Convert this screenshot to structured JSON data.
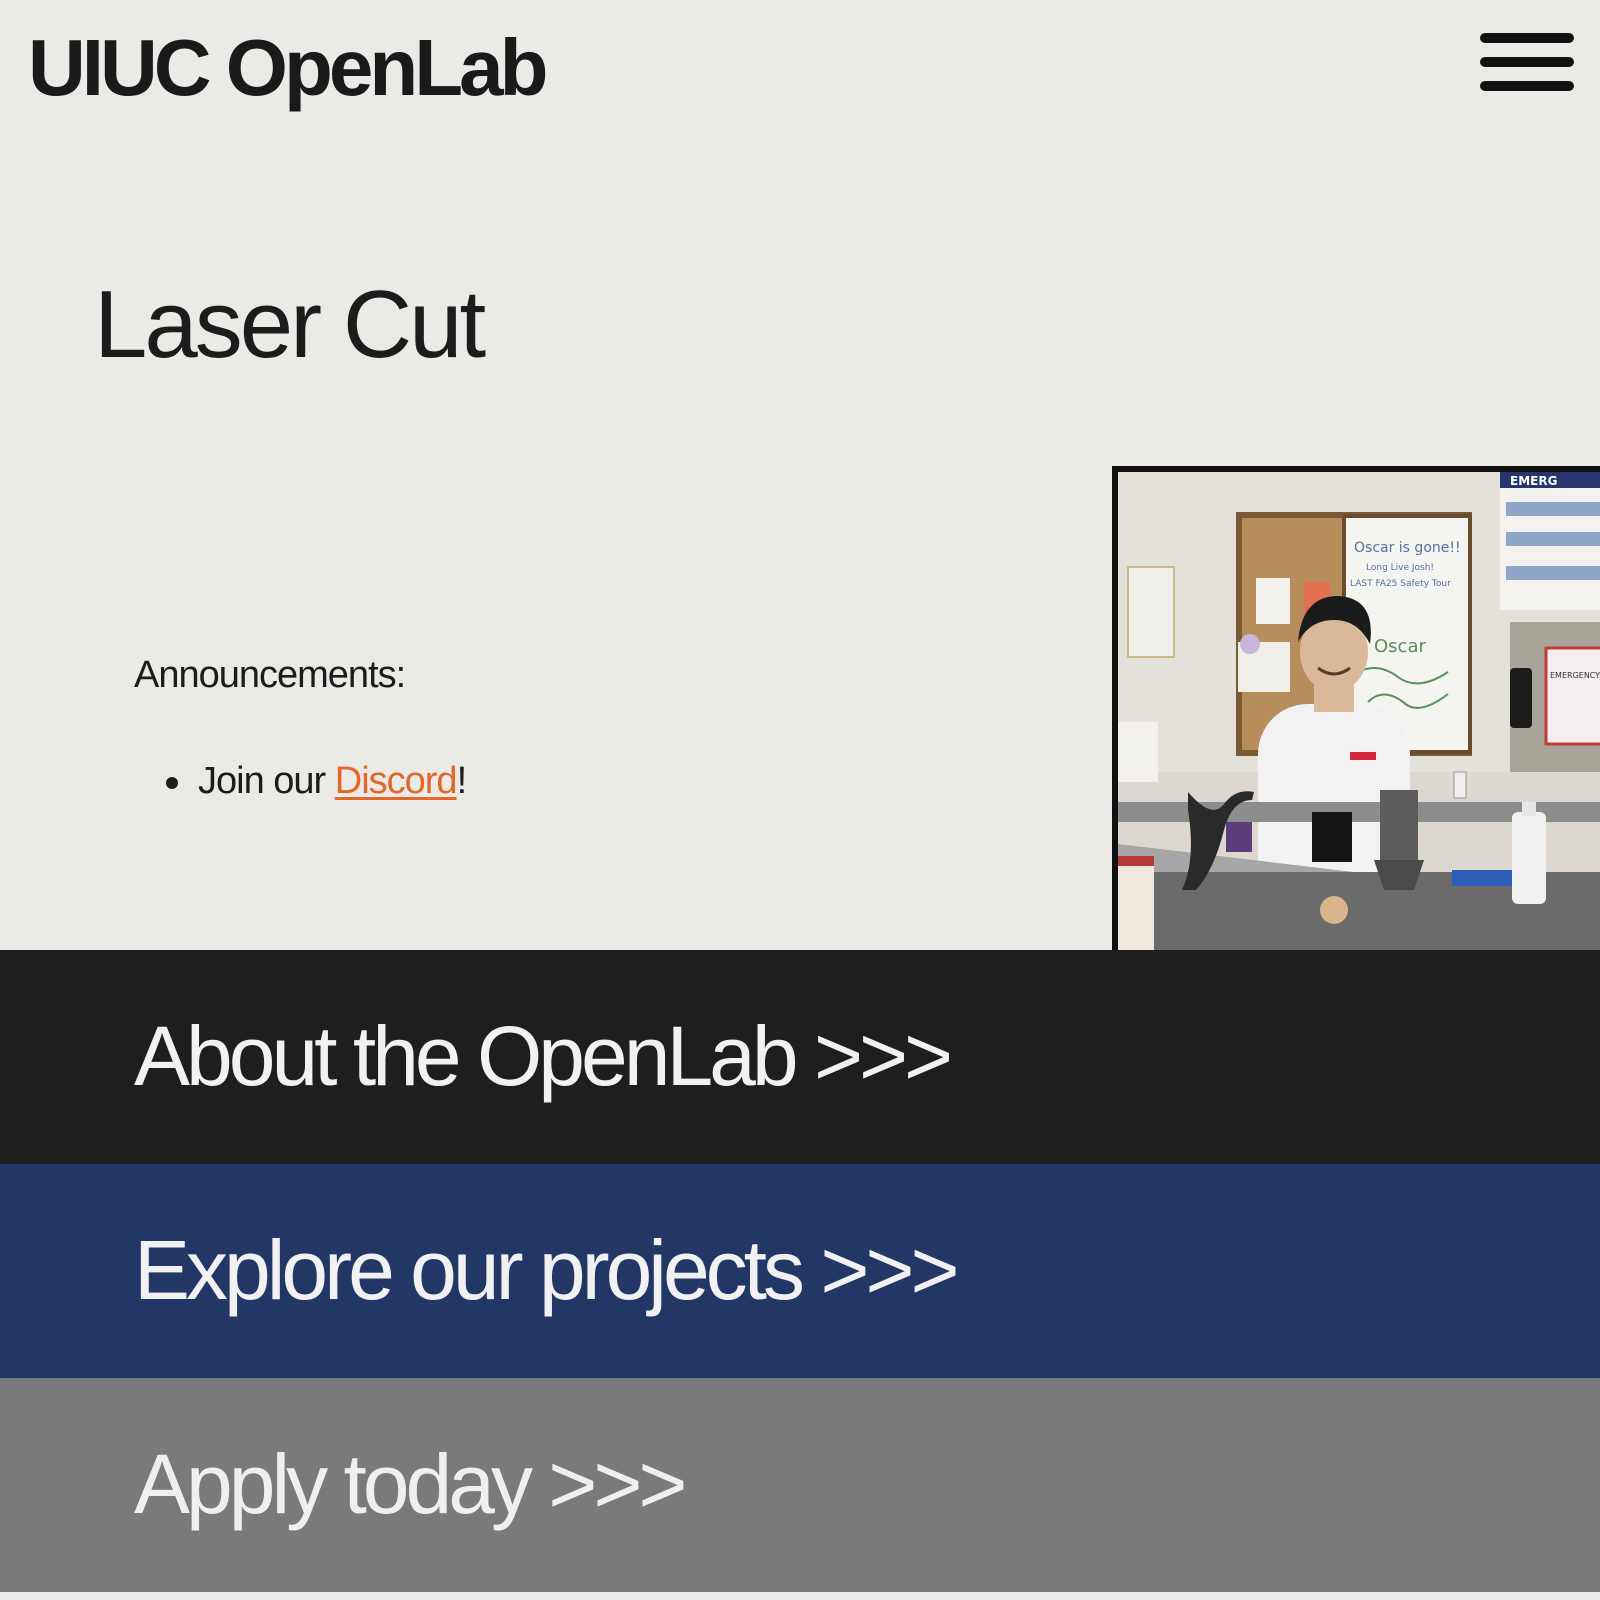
{
  "header": {
    "site_title": "UIUC OpenLab",
    "menu_icon": "hamburger-menu-icon"
  },
  "main": {
    "page_heading": "Laser Cut",
    "announcements_label": "Announcements:",
    "announcements": [
      {
        "prefix": "Join our ",
        "link_text": "Discord",
        "suffix": "!"
      }
    ]
  },
  "photo": {
    "subject": "lab-photo",
    "whiteboard_text": [
      "Oscar is gone!!",
      "Long Live Josh!",
      "LAST FA25 Safety Tour",
      "Oscar"
    ],
    "sign_text": "EMERGENCY PHONE",
    "poster_text": "EMERG"
  },
  "nav_bands": {
    "about": "About the OpenLab >>>",
    "projects": "Explore our projects >>>",
    "apply": "Apply today >>>"
  },
  "colors": {
    "background": "#ebeae7",
    "link": "#e0692a",
    "about_band": "#1e1e1e",
    "projects_band": "#233767",
    "apply_band": "#7a7a7a"
  }
}
